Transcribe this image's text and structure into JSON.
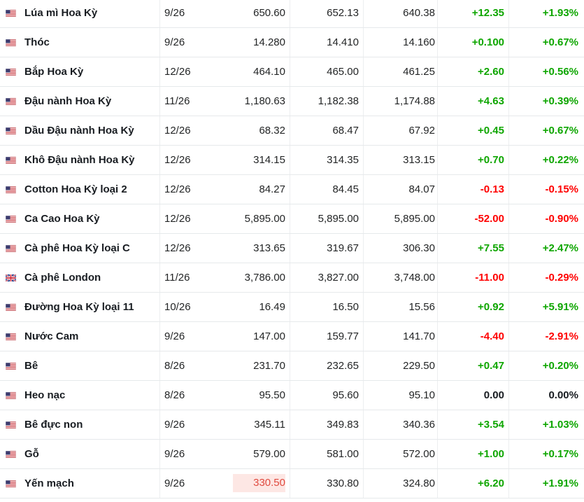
{
  "colors": {
    "up": "#0ea600",
    "down": "#ff0000",
    "flat": "#181c21",
    "highlight_bg": "#fde7e4"
  },
  "rows": [
    {
      "flag": "us-flag-icon",
      "name": "Lúa mì Hoa Kỳ",
      "month": "9/26",
      "last": "650.60",
      "high": "652.13",
      "low": "640.38",
      "chg": "+12.35",
      "pct": "+1.93%",
      "dir": "up"
    },
    {
      "flag": "us-flag-icon",
      "name": "Thóc",
      "month": "9/26",
      "last": "14.280",
      "high": "14.410",
      "low": "14.160",
      "chg": "+0.100",
      "pct": "+0.67%",
      "dir": "up"
    },
    {
      "flag": "us-flag-icon",
      "name": "Bắp Hoa Kỳ",
      "month": "12/26",
      "last": "464.10",
      "high": "465.00",
      "low": "461.25",
      "chg": "+2.60",
      "pct": "+0.56%",
      "dir": "up"
    },
    {
      "flag": "us-flag-icon",
      "name": "Đậu nành Hoa Kỳ",
      "month": "11/26",
      "last": "1,180.63",
      "high": "1,182.38",
      "low": "1,174.88",
      "chg": "+4.63",
      "pct": "+0.39%",
      "dir": "up"
    },
    {
      "flag": "us-flag-icon",
      "name": "Dầu Đậu nành Hoa Kỳ",
      "month": "12/26",
      "last": "68.32",
      "high": "68.47",
      "low": "67.92",
      "chg": "+0.45",
      "pct": "+0.67%",
      "dir": "up"
    },
    {
      "flag": "us-flag-icon",
      "name": "Khô Đậu nành Hoa Kỳ",
      "month": "12/26",
      "last": "314.15",
      "high": "314.35",
      "low": "313.15",
      "chg": "+0.70",
      "pct": "+0.22%",
      "dir": "up"
    },
    {
      "flag": "us-flag-icon",
      "name": "Cotton Hoa Kỳ loại 2",
      "month": "12/26",
      "last": "84.27",
      "high": "84.45",
      "low": "84.07",
      "chg": "-0.13",
      "pct": "-0.15%",
      "dir": "down"
    },
    {
      "flag": "us-flag-icon",
      "name": "Ca Cao Hoa Kỳ",
      "month": "12/26",
      "last": "5,895.00",
      "high": "5,895.00",
      "low": "5,895.00",
      "chg": "-52.00",
      "pct": "-0.90%",
      "dir": "down"
    },
    {
      "flag": "us-flag-icon",
      "name": "Cà phê Hoa Kỳ loại C",
      "month": "12/26",
      "last": "313.65",
      "high": "319.67",
      "low": "306.30",
      "chg": "+7.55",
      "pct": "+2.47%",
      "dir": "up"
    },
    {
      "flag": "uk-flag-icon",
      "name": "Cà phê London",
      "month": "11/26",
      "last": "3,786.00",
      "high": "3,827.00",
      "low": "3,748.00",
      "chg": "-11.00",
      "pct": "-0.29%",
      "dir": "down"
    },
    {
      "flag": "us-flag-icon",
      "name": "Đường Hoa Kỳ loại 11",
      "month": "10/26",
      "last": "16.49",
      "high": "16.50",
      "low": "15.56",
      "chg": "+0.92",
      "pct": "+5.91%",
      "dir": "up"
    },
    {
      "flag": "us-flag-icon",
      "name": "Nước Cam",
      "month": "9/26",
      "last": "147.00",
      "high": "159.77",
      "low": "141.70",
      "chg": "-4.40",
      "pct": "-2.91%",
      "dir": "down"
    },
    {
      "flag": "us-flag-icon",
      "name": "Bê",
      "month": "8/26",
      "last": "231.70",
      "high": "232.65",
      "low": "229.50",
      "chg": "+0.47",
      "pct": "+0.20%",
      "dir": "up"
    },
    {
      "flag": "us-flag-icon",
      "name": "Heo nạc",
      "month": "8/26",
      "last": "95.50",
      "high": "95.60",
      "low": "95.10",
      "chg": "0.00",
      "pct": "0.00%",
      "dir": "flat"
    },
    {
      "flag": "us-flag-icon",
      "name": "Bê đực non",
      "month": "9/26",
      "last": "345.11",
      "high": "349.83",
      "low": "340.36",
      "chg": "+3.54",
      "pct": "+1.03%",
      "dir": "up"
    },
    {
      "flag": "us-flag-icon",
      "name": "Gỗ",
      "month": "9/26",
      "last": "579.00",
      "high": "581.00",
      "low": "572.00",
      "chg": "+1.00",
      "pct": "+0.17%",
      "dir": "up"
    },
    {
      "flag": "us-flag-icon",
      "name": "Yến mạch",
      "month": "9/26",
      "last": "330.50",
      "high": "330.80",
      "low": "324.80",
      "chg": "+6.20",
      "pct": "+1.91%",
      "dir": "up",
      "last_highlight": true
    }
  ]
}
